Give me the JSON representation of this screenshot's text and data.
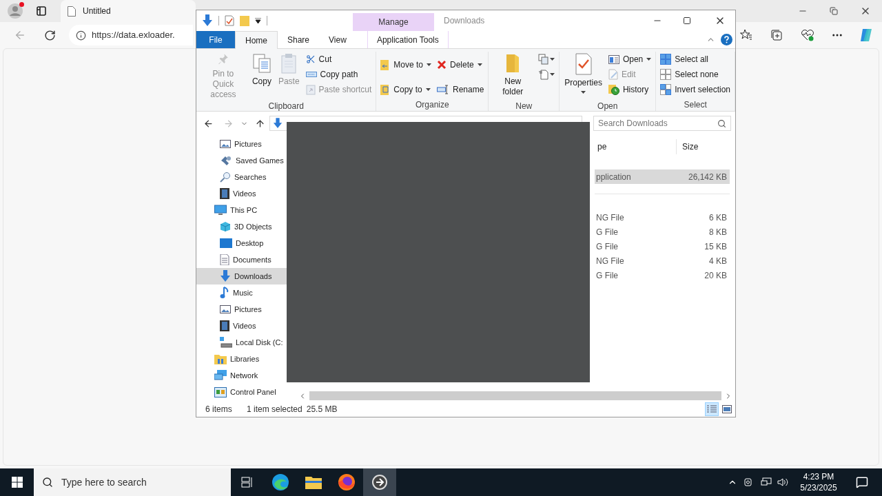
{
  "browser": {
    "tab": {
      "title": "Untitled",
      "selected": true
    },
    "address": "https://data.exloader."
  },
  "explorer": {
    "title": "Downloads",
    "context_tab": {
      "group": "Manage",
      "label": "Application Tools"
    },
    "tabs": [
      {
        "label": "File",
        "selected": false,
        "kind": "file"
      },
      {
        "label": "Home",
        "selected": true,
        "kind": "tab"
      },
      {
        "label": "Share",
        "selected": false,
        "kind": "tab"
      },
      {
        "label": "View",
        "selected": false,
        "kind": "tab"
      }
    ],
    "ribbon": [
      {
        "name": "Clipboard",
        "columns": [
          [
            {
              "kind": "large",
              "label": "Pin to Quick access",
              "disabled": true,
              "has_menu": false
            }
          ],
          [
            {
              "kind": "large",
              "label": "Copy",
              "disabled": false,
              "has_menu": false
            }
          ],
          [
            {
              "kind": "large",
              "label": "Paste",
              "disabled": true,
              "has_menu": false
            }
          ],
          [
            {
              "kind": "small",
              "label": "Cut",
              "disabled": false,
              "has_menu": false
            },
            {
              "kind": "small",
              "label": "Copy path",
              "disabled": false,
              "has_menu": false
            },
            {
              "kind": "small",
              "label": "Paste shortcut",
              "disabled": true,
              "has_menu": false
            }
          ]
        ]
      },
      {
        "name": "Organize",
        "columns": [
          [
            {
              "kind": "small",
              "label": "Move to",
              "disabled": false,
              "has_menu": true
            },
            {
              "kind": "small",
              "label": "Copy to",
              "disabled": false,
              "has_menu": true
            }
          ],
          [
            {
              "kind": "small",
              "label": "Delete",
              "disabled": false,
              "has_menu": true
            },
            {
              "kind": "small",
              "label": "Rename",
              "disabled": false,
              "has_menu": false
            }
          ]
        ]
      },
      {
        "name": "New",
        "columns": [
          [
            {
              "kind": "large",
              "label": "New folder",
              "disabled": false,
              "has_menu": false
            }
          ],
          [
            {
              "kind": "icon",
              "disabled": false,
              "has_menu": true
            },
            {
              "kind": "icon",
              "disabled": false,
              "has_menu": true
            }
          ]
        ]
      },
      {
        "name": "Open",
        "columns": [
          [
            {
              "kind": "large",
              "label": "Properties",
              "disabled": false,
              "has_menu": true
            }
          ],
          [
            {
              "kind": "small",
              "label": "Open",
              "disabled": false,
              "has_menu": true
            },
            {
              "kind": "small",
              "label": "Edit",
              "disabled": true,
              "has_menu": false
            },
            {
              "kind": "small",
              "label": "History",
              "disabled": false,
              "has_menu": false
            }
          ]
        ]
      },
      {
        "name": "Select",
        "columns": [
          [
            {
              "kind": "small",
              "label": "Select all",
              "disabled": false,
              "has_menu": false
            },
            {
              "kind": "small",
              "label": "Select none",
              "disabled": false,
              "has_menu": false
            },
            {
              "kind": "small",
              "label": "Invert selection",
              "disabled": false,
              "has_menu": false
            }
          ]
        ]
      }
    ],
    "search": {
      "placeholder": "Search Downloads"
    },
    "nav_pane": {
      "continued_items": [
        {
          "label": "Pictures",
          "selected": false
        },
        {
          "label": "Saved Games",
          "selected": false
        },
        {
          "label": "Searches",
          "selected": false
        },
        {
          "label": "Videos",
          "selected": false
        }
      ],
      "items": [
        {
          "label": "This PC",
          "selected": false,
          "children": [
            {
              "label": "3D Objects",
              "selected": false
            },
            {
              "label": "Desktop",
              "selected": false
            },
            {
              "label": "Documents",
              "selected": false
            },
            {
              "label": "Downloads",
              "selected": true
            },
            {
              "label": "Music",
              "selected": false
            },
            {
              "label": "Pictures",
              "selected": false
            },
            {
              "label": "Videos",
              "selected": false
            },
            {
              "label": "Local Disk (C:",
              "selected": false
            }
          ]
        },
        {
          "label": "Libraries",
          "selected": false
        },
        {
          "label": "Network",
          "selected": false
        },
        {
          "label": "Control Panel",
          "selected": false
        }
      ]
    },
    "columns": [
      "pe",
      "Size"
    ],
    "groups": [
      {
        "rows": [
          {
            "type": "pplication",
            "size": "26,142 KB",
            "selected": true
          }
        ]
      },
      {
        "rows": [
          {
            "type": "NG File",
            "size": "6 KB",
            "selected": false
          },
          {
            "type": "G File",
            "size": "8 KB",
            "selected": false
          },
          {
            "type": "G File",
            "size": "15 KB",
            "selected": false
          },
          {
            "type": "NG File",
            "size": "4 KB",
            "selected": false
          },
          {
            "type": "G File",
            "size": "20 KB",
            "selected": false
          }
        ]
      }
    ],
    "status_bar": {
      "items": "6 items",
      "selection": "1 item selected",
      "size": "25.5 MB"
    },
    "views": [
      {
        "kind": "details",
        "selected": true
      },
      {
        "kind": "thumbnails",
        "selected": false
      }
    ]
  },
  "taskbar": {
    "search": {
      "placeholder": "Type here to search"
    },
    "apps": [
      {
        "kind": "task-view",
        "selected": false
      },
      {
        "kind": "edge",
        "selected": false
      },
      {
        "kind": "explorer",
        "selected": false
      },
      {
        "kind": "firefox",
        "selected": false
      },
      {
        "kind": "app",
        "selected": true
      }
    ],
    "time": "4:23 PM",
    "date": "5/23/2025"
  }
}
